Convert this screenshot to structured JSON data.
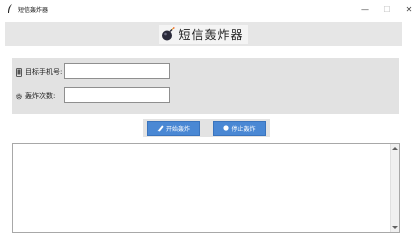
{
  "window": {
    "title": "短信轰炸器",
    "controls": {
      "minimize": "—",
      "maximize": "☐",
      "close": "✕"
    }
  },
  "header": {
    "logo_text": "短信轰炸器",
    "logo_icon": "bomb-icon"
  },
  "form": {
    "phone_label": "目标手机号:",
    "phone_icon": "phone-icon",
    "phone_value": "",
    "count_label": "轰炸次数:",
    "count_icon": "gear-icon",
    "count_value": ""
  },
  "buttons": {
    "start_label": "开始轰炸",
    "start_icon": "rocket-icon",
    "stop_label": "停止轰炸",
    "stop_icon": "stop-icon",
    "accent": "#4a88d4"
  },
  "log": {
    "content": ""
  }
}
